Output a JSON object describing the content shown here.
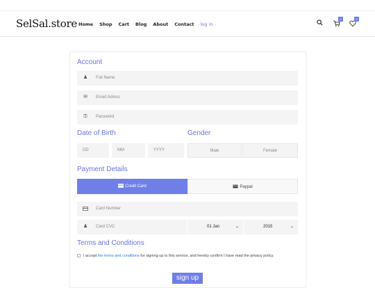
{
  "header": {
    "brand": "SelSal.store",
    "nav": [
      "Home",
      "Shop",
      "Cart",
      "Blog",
      "About",
      "Contact"
    ],
    "login": "log in",
    "cart_count": "0",
    "wishlist_count": "0"
  },
  "form": {
    "account_title": "Account",
    "full_name_placeholder": "Full Name",
    "email_placeholder": "Email Adress",
    "password_placeholder": "Password",
    "dob_title": "Date of Birth",
    "gender_title": "Gender",
    "dd": "DD",
    "mm": "MM",
    "yyyy": "YYYY",
    "male": "Male",
    "female": "Female",
    "payment_title": "Payment Details",
    "credit_card": "Credit Card",
    "paypal": "Paypal",
    "card_number_placeholder": "Card Number",
    "card_cvc_placeholder": "Card CVC",
    "exp_month": "01 Jan",
    "exp_year": "2015",
    "terms_title": "Terms and Conditions",
    "terms_pre": "I accept ",
    "terms_link": "the terms and conditions",
    "terms_post": " for signing up to this service, and hereby confirm I have read the privacy policy.",
    "signup": "sign up"
  },
  "colors": {
    "accent": "#6f7fe8",
    "link": "#2a7fd4",
    "field_bg": "#f4f4f4"
  }
}
